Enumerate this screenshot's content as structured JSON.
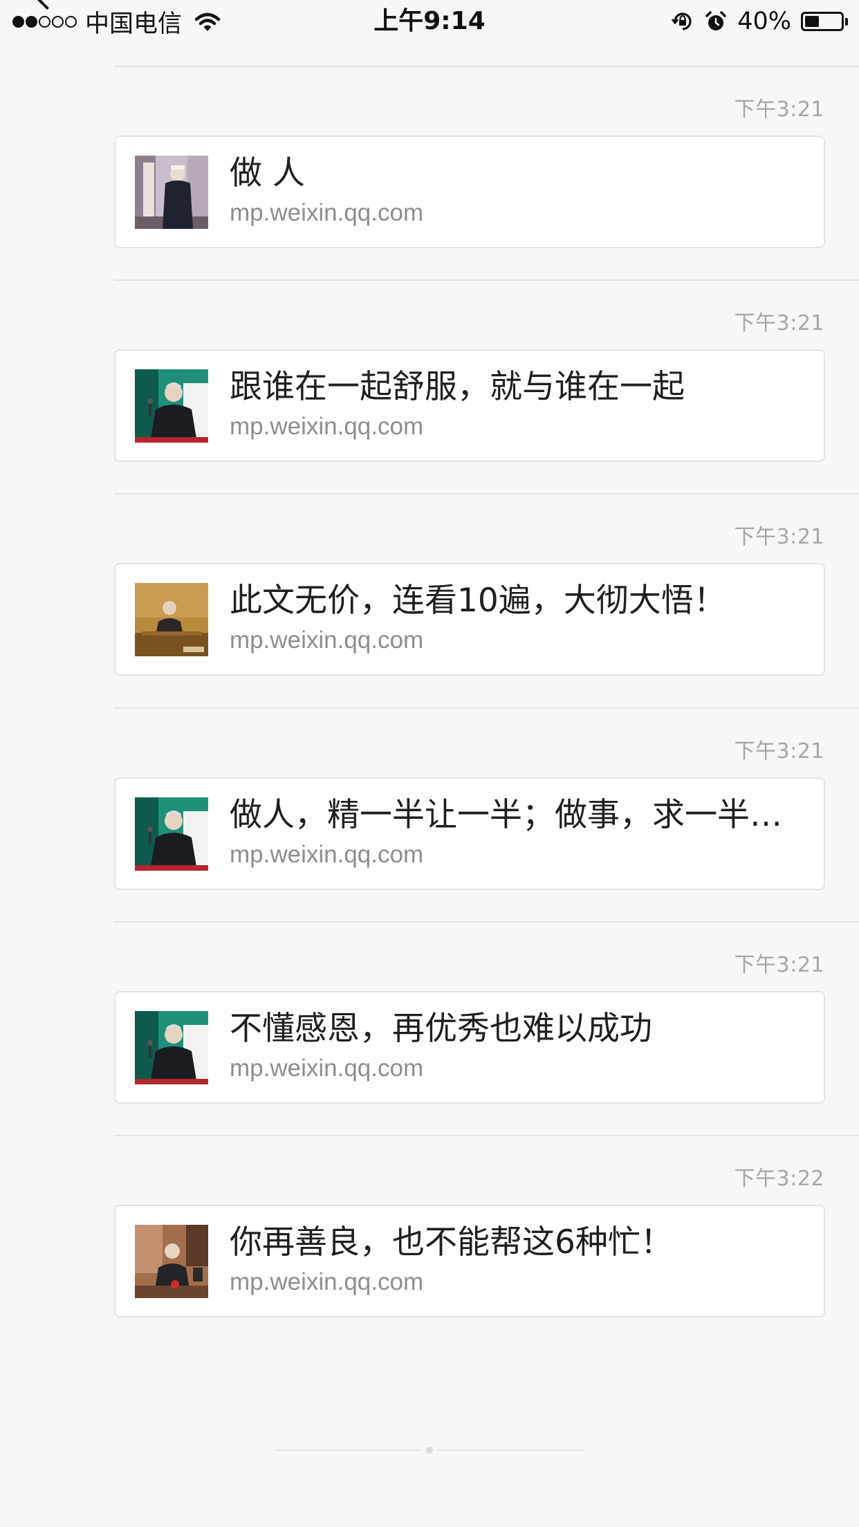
{
  "status_bar": {
    "carrier": "中国电信",
    "time": "上午9:14",
    "battery": "40%",
    "battery_level": 0.4,
    "signal": {
      "filled": 2,
      "total": 5
    }
  },
  "messages": [
    {
      "time": "下午3:21",
      "title": "做  人",
      "source": "mp.weixin.qq.com",
      "thumb": "standing-man"
    },
    {
      "time": "下午3:21",
      "title": "跟谁在一起舒服，就与谁在一起",
      "source": "mp.weixin.qq.com",
      "thumb": "speaker-green"
    },
    {
      "time": "下午3:21",
      "title": "此文无价，连看10遍，大彻大悟！",
      "source": "mp.weixin.qq.com",
      "thumb": "lecture-gold"
    },
    {
      "time": "下午3:21",
      "title": "做人，精一半让一半；做事，求一半…",
      "source": "mp.weixin.qq.com",
      "thumb": "speaker-green"
    },
    {
      "time": "下午3:21",
      "title": "不懂感恩，再优秀也难以成功",
      "source": "mp.weixin.qq.com",
      "thumb": "speaker-green"
    },
    {
      "time": "下午3:22",
      "title": "你再善良，也不能帮这6种忙！",
      "source": "mp.weixin.qq.com",
      "thumb": "seated-brown"
    }
  ]
}
